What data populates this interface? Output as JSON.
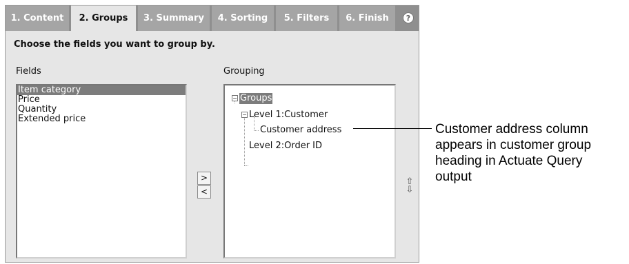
{
  "tabs": [
    {
      "label": "1. Content",
      "active": false
    },
    {
      "label": "2. Groups",
      "active": true
    },
    {
      "label": "3. Summary",
      "active": false
    },
    {
      "label": "4. Sorting",
      "active": false
    },
    {
      "label": "5. Filters",
      "active": false
    },
    {
      "label": "6. Finish",
      "active": false
    }
  ],
  "help_label": "?",
  "instruction": "Choose the fields you want to group by.",
  "fields": {
    "label": "Fields",
    "items": [
      "Item category",
      "Price",
      "Quantity",
      "Extended price"
    ],
    "selected": "Item category"
  },
  "buttons": {
    "add": ">",
    "remove": "<"
  },
  "grouping": {
    "label": "Grouping",
    "root": "Groups",
    "level1": "Level 1:Customer",
    "level1_child": "Customer address",
    "level2": "Level 2:Order ID"
  },
  "order_arrows": {
    "up": "⇧",
    "down": "⇩"
  },
  "callout": {
    "lines": [
      "Customer address column",
      "appears in customer group",
      "heading in Actuate Query",
      "output"
    ]
  },
  "colors": {
    "tab_bar": "#8f8f8f",
    "tab_inactive": "#a5a5a5",
    "panel": "#e6e6e6",
    "selection": "#7c7c7c"
  }
}
